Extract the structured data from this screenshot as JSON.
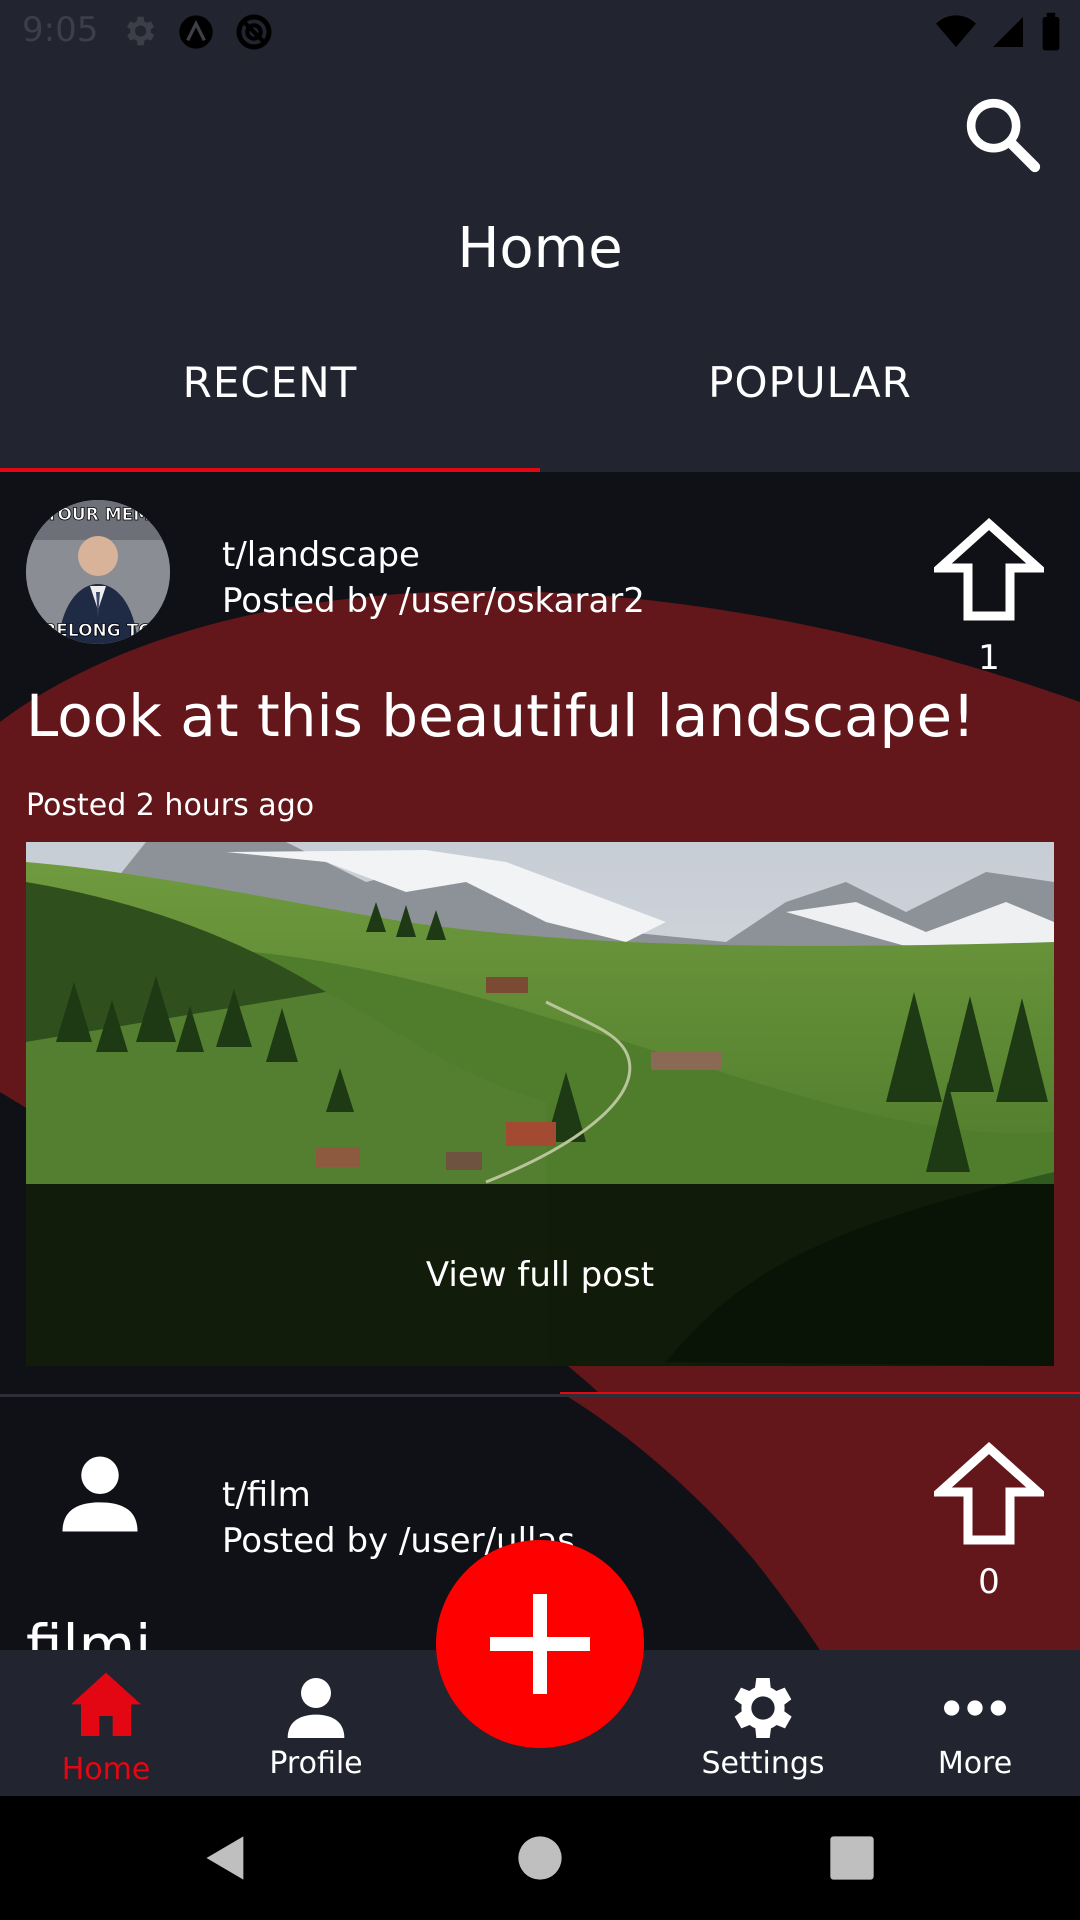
{
  "status_bar": {
    "time": "9:05"
  },
  "header": {
    "title": "Home",
    "search_icon": "search-icon"
  },
  "tabs": [
    {
      "label": "RECENT",
      "selected": true
    },
    {
      "label": "POPULAR",
      "selected": false
    }
  ],
  "posts": [
    {
      "community": "t/landscape",
      "author": "Posted by /user/oskarar2",
      "title": "Look at this beautiful landscape!",
      "time": "Posted 2 hours ago",
      "votes": "1",
      "view_label": "View full post",
      "avatar_text_top": "YOUR MEM",
      "avatar_text_bottom": "BELONG TO"
    },
    {
      "community": "t/film",
      "author": "Posted by /user/ullas",
      "title": "filmi",
      "votes": "0"
    }
  ],
  "bottom_nav": [
    {
      "label": "Home",
      "icon": "home-icon",
      "active": true
    },
    {
      "label": "Profile",
      "icon": "person-icon",
      "active": false
    },
    {
      "label": "Settings",
      "icon": "gear-icon",
      "active": false
    },
    {
      "label": "More",
      "icon": "more-icon",
      "active": false
    }
  ],
  "colors": {
    "accent": "#e30613",
    "bar": "#22242f",
    "feed": "#101116",
    "swoosh": "#63171b",
    "fab": "#ff0000"
  }
}
